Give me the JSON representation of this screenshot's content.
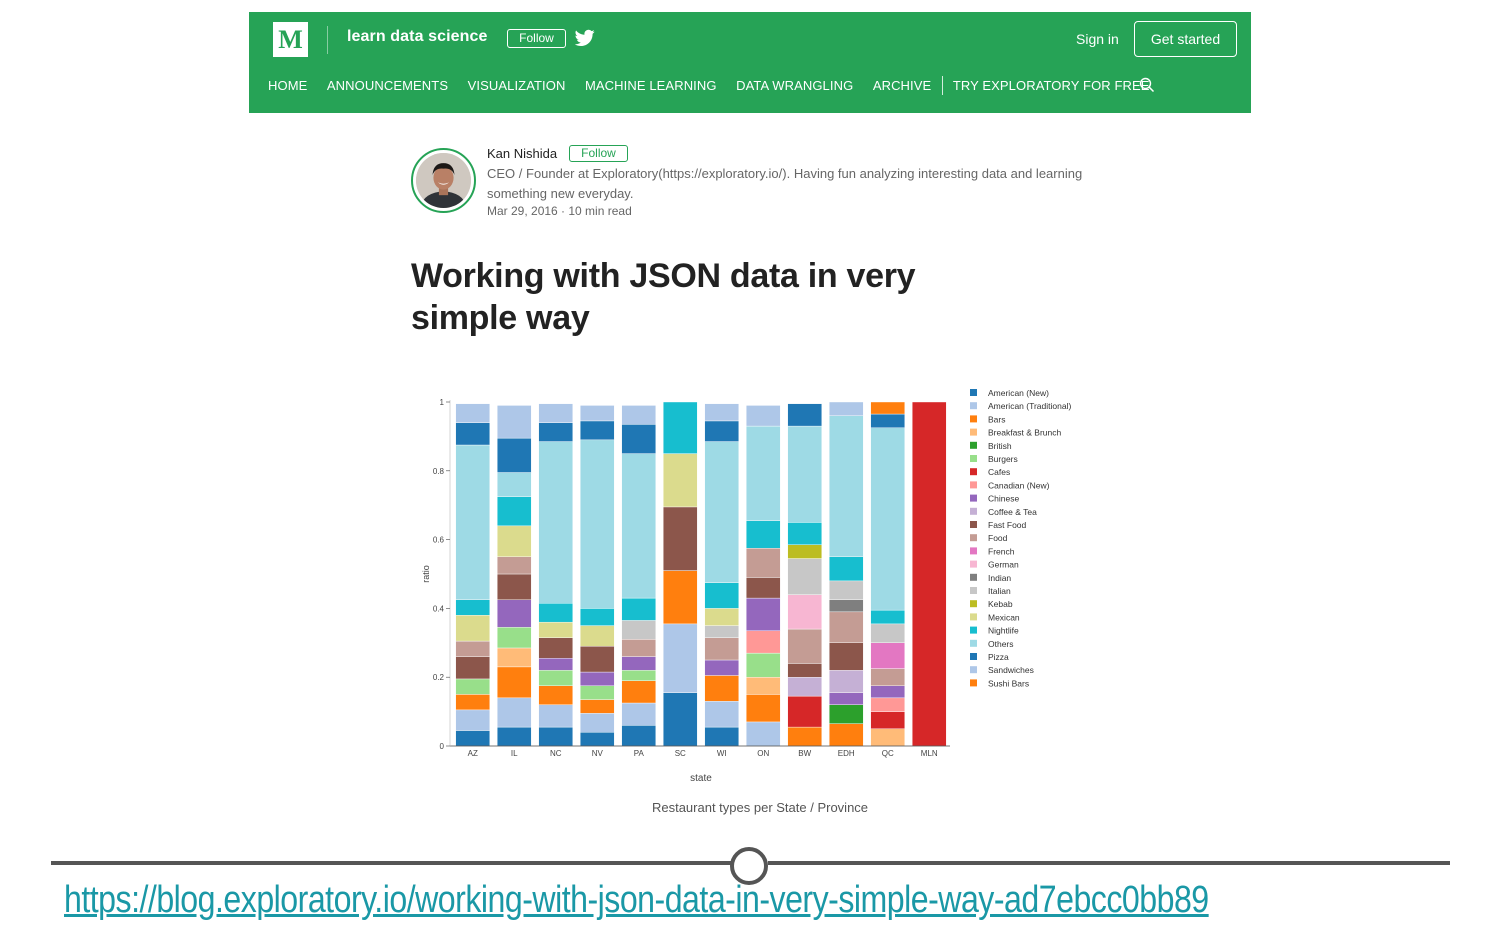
{
  "header": {
    "logo_text": "M",
    "publication_name": "learn data science",
    "follow_label": "Follow",
    "sign_in_label": "Sign in",
    "get_started_label": "Get started",
    "brand_color": "#26a356",
    "nav_items": [
      "HOME",
      "ANNOUNCEMENTS",
      "VISUALIZATION",
      "MACHINE LEARNING",
      "DATA WRANGLING",
      "ARCHIVE"
    ],
    "nav_cta": "TRY EXPLORATORY FOR FREE"
  },
  "author": {
    "name": "Kan Nishida",
    "follow_label": "Follow",
    "bio": "CEO / Founder at Exploratory(https://exploratory.io/). Having fun analyzing interesting data and learning something new everyday.",
    "meta": "Mar 29, 2016 · 10 min read"
  },
  "post": {
    "title": "Working with JSON data in very simple way"
  },
  "chart_data": {
    "type": "bar",
    "stacked": true,
    "xlabel": "state",
    "ylabel": "ratio",
    "ylim": [
      0,
      1
    ],
    "yticks": [
      "0",
      "0.2",
      "0.4",
      "0.6",
      "0.8",
      "1"
    ],
    "categories": [
      "AZ",
      "IL",
      "NC",
      "NV",
      "PA",
      "SC",
      "WI",
      "ON",
      "BW",
      "EDH",
      "QC",
      "MLN"
    ],
    "legend_position": "right",
    "series": [
      {
        "name": "American (New)",
        "color": "#1f77b4",
        "values": [
          0.045,
          0.055,
          0.055,
          0.04,
          0.06,
          0.155,
          0.055,
          0,
          0,
          0,
          0,
          0
        ]
      },
      {
        "name": "American (Traditional)",
        "color": "#aec7e8",
        "values": [
          0.06,
          0.085,
          0.065,
          0.055,
          0.065,
          0.2,
          0.075,
          0.07,
          0,
          0,
          0,
          0
        ]
      },
      {
        "name": "Bars",
        "color": "#ff7f0e",
        "values": [
          0.045,
          0.09,
          0.055,
          0.04,
          0.065,
          0.155,
          0.075,
          0.08,
          0.055,
          0.065,
          0,
          0
        ]
      },
      {
        "name": "Breakfast & Brunch",
        "color": "#ffbb78",
        "values": [
          0,
          0.055,
          0,
          0,
          0,
          0,
          0,
          0.05,
          0,
          0,
          0.05,
          0
        ]
      },
      {
        "name": "British",
        "color": "#2ca02c",
        "values": [
          0,
          0,
          0,
          0,
          0,
          0,
          0,
          0,
          0,
          0.055,
          0,
          0
        ]
      },
      {
        "name": "Burgers",
        "color": "#98df8a",
        "values": [
          0.045,
          0.06,
          0.045,
          0.04,
          0.03,
          0,
          0,
          0.07,
          0,
          0,
          0,
          0
        ]
      },
      {
        "name": "Cafes",
        "color": "#d62728",
        "values": [
          0,
          0,
          0,
          0,
          0,
          0,
          0,
          0,
          0.09,
          0,
          0.05,
          1.0
        ]
      },
      {
        "name": "Canadian (New)",
        "color": "#ff9896",
        "values": [
          0,
          0,
          0,
          0,
          0,
          0,
          0,
          0.065,
          0,
          0,
          0.04,
          0
        ]
      },
      {
        "name": "Chinese",
        "color": "#9467bd",
        "values": [
          0,
          0.08,
          0.035,
          0.04,
          0.04,
          0,
          0.045,
          0.095,
          0,
          0.035,
          0.035,
          0
        ]
      },
      {
        "name": "Coffee & Tea",
        "color": "#c5b0d5",
        "values": [
          0,
          0,
          0,
          0,
          0,
          0,
          0,
          0,
          0.055,
          0.065,
          0,
          0
        ]
      },
      {
        "name": "Fast Food",
        "color": "#8c564b",
        "values": [
          0.065,
          0.075,
          0.06,
          0.075,
          0,
          0.185,
          0,
          0.06,
          0.04,
          0.08,
          0,
          0
        ]
      },
      {
        "name": "Food",
        "color": "#c49c94",
        "values": [
          0.045,
          0.05,
          0,
          0,
          0.05,
          0,
          0.065,
          0.085,
          0.1,
          0.09,
          0.05,
          0
        ]
      },
      {
        "name": "French",
        "color": "#e377c2",
        "values": [
          0,
          0,
          0,
          0,
          0,
          0,
          0,
          0,
          0,
          0,
          0.075,
          0
        ]
      },
      {
        "name": "German",
        "color": "#f7b6d2",
        "values": [
          0,
          0,
          0,
          0,
          0,
          0,
          0,
          0,
          0.1,
          0,
          0,
          0
        ]
      },
      {
        "name": "Indian",
        "color": "#7f7f7f",
        "values": [
          0,
          0,
          0,
          0,
          0,
          0,
          0,
          0,
          0,
          0.035,
          0,
          0
        ]
      },
      {
        "name": "Italian",
        "color": "#c7c7c7",
        "values": [
          0,
          0,
          0,
          0,
          0.055,
          0,
          0.035,
          0,
          0.105,
          0.055,
          0.055,
          0
        ]
      },
      {
        "name": "Kebab",
        "color": "#bcbd22",
        "values": [
          0,
          0,
          0,
          0,
          0,
          0,
          0,
          0,
          0.04,
          0,
          0,
          0
        ]
      },
      {
        "name": "Mexican",
        "color": "#dbdb8d",
        "values": [
          0.075,
          0.09,
          0.045,
          0.06,
          0,
          0.155,
          0.05,
          0,
          0,
          0,
          0,
          0
        ]
      },
      {
        "name": "Nightlife",
        "color": "#17becf",
        "values": [
          0.045,
          0.085,
          0.055,
          0.05,
          0.065,
          0.15,
          0.075,
          0.08,
          0.065,
          0.07,
          0.04,
          0
        ]
      },
      {
        "name": "Others",
        "color": "#9edae5",
        "values": [
          0.45,
          0.07,
          0.47,
          0.49,
          0.42,
          0,
          0.41,
          0.275,
          0.28,
          0.41,
          0.53,
          0
        ]
      },
      {
        "name": "Pizza",
        "color": "#1f77b4",
        "values": [
          0.065,
          0.1,
          0.055,
          0.055,
          0.085,
          0,
          0.06,
          0,
          0.065,
          0,
          0.04,
          0
        ]
      },
      {
        "name": "Sandwiches",
        "color": "#aec7e8",
        "values": [
          0.055,
          0.095,
          0.055,
          0.045,
          0.055,
          0,
          0.05,
          0.06,
          0,
          0.04,
          0,
          0
        ]
      },
      {
        "name": "Sushi Bars",
        "color": "#ff7f0e",
        "values": [
          0,
          0,
          0,
          0,
          0,
          0,
          0,
          0,
          0,
          0,
          0.035,
          0
        ]
      }
    ]
  },
  "caption": "Restaurant types per State / Province",
  "footer": {
    "url": "https://blog.exploratory.io/working-with-json-data-in-very-simple-way-ad7ebcc0bb89",
    "link_color": "#1a98a6"
  }
}
